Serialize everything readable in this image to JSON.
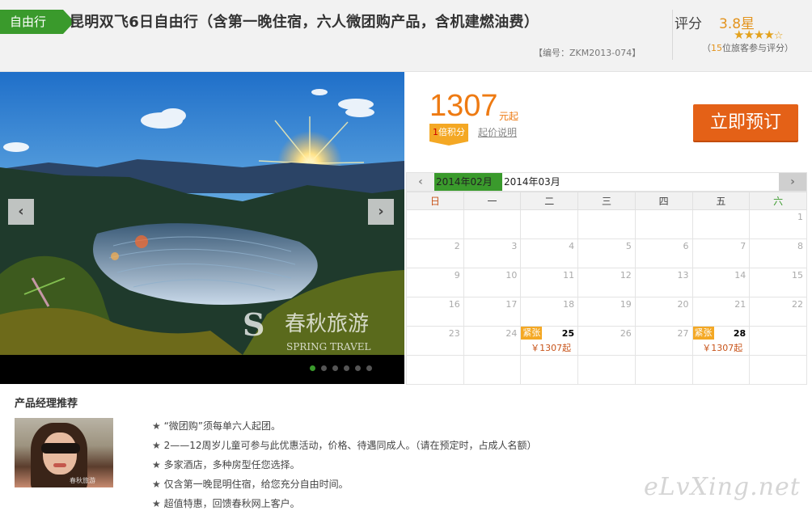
{
  "header": {
    "tag": "自由行",
    "title": "昆明双飞6日自由行（含第一晚住宿，六人微团购产品，含机建燃油费）",
    "code": "【编号：ZKM2013-074】",
    "rating_label": "评分",
    "rating_value": "3.8星",
    "stars": 3.8,
    "review_prefix": "（",
    "review_count": "15",
    "review_suffix": "位旅客参与评分）"
  },
  "gallery": {
    "prev_icon": "‹",
    "next_icon": "›",
    "brand_cn": "春秋旅游",
    "brand_en": "SPRING TRAVEL",
    "slide_count": 6,
    "active_slide": 1
  },
  "pricing": {
    "price": "1307",
    "unit": "元起",
    "points_num": "1",
    "points_text": "倍积分",
    "explain": "起价说明",
    "book_button": "立即预订"
  },
  "calendar": {
    "prev_icon": "‹",
    "next_icon": "›",
    "month_selected": "2014年02月",
    "month_other": "2014年03月",
    "weekdays": [
      "日",
      "一",
      "二",
      "三",
      "四",
      "五",
      "六"
    ],
    "rows": [
      [
        {
          "d": ""
        },
        {
          "d": ""
        },
        {
          "d": ""
        },
        {
          "d": ""
        },
        {
          "d": ""
        },
        {
          "d": ""
        },
        {
          "d": "1"
        }
      ],
      [
        {
          "d": "2"
        },
        {
          "d": "3"
        },
        {
          "d": "4"
        },
        {
          "d": "5"
        },
        {
          "d": "6"
        },
        {
          "d": "7"
        },
        {
          "d": "8"
        }
      ],
      [
        {
          "d": "9"
        },
        {
          "d": "10"
        },
        {
          "d": "11"
        },
        {
          "d": "12"
        },
        {
          "d": "13"
        },
        {
          "d": "14"
        },
        {
          "d": "15"
        }
      ],
      [
        {
          "d": "16"
        },
        {
          "d": "17"
        },
        {
          "d": "18"
        },
        {
          "d": "19"
        },
        {
          "d": "20"
        },
        {
          "d": "21"
        },
        {
          "d": "22"
        }
      ],
      [
        {
          "d": "23"
        },
        {
          "d": "24"
        },
        {
          "d": "25",
          "tag": "紧张",
          "price": "￥1307起"
        },
        {
          "d": "26"
        },
        {
          "d": "27"
        },
        {
          "d": "28",
          "tag": "紧张",
          "price": "￥1307起"
        },
        {
          "d": ""
        }
      ],
      [
        {
          "d": ""
        },
        {
          "d": ""
        },
        {
          "d": ""
        },
        {
          "d": ""
        },
        {
          "d": ""
        },
        {
          "d": ""
        },
        {
          "d": ""
        }
      ]
    ]
  },
  "manager": {
    "title": "产品经理推荐",
    "avatar_watermark": "春秋旅游",
    "items": [
      "“微团购”须每单六人起团。",
      "2——12周岁儿童可参与此优惠活动，价格、待遇同成人。（请在预定时，占成人名额）",
      "多家酒店，多种房型任您选择。",
      "仅含第一晚昆明住宿，给您充分自由时间。",
      "超值特惠，回馈春秋网上客户。"
    ]
  },
  "watermark": "eLvXing.net"
}
